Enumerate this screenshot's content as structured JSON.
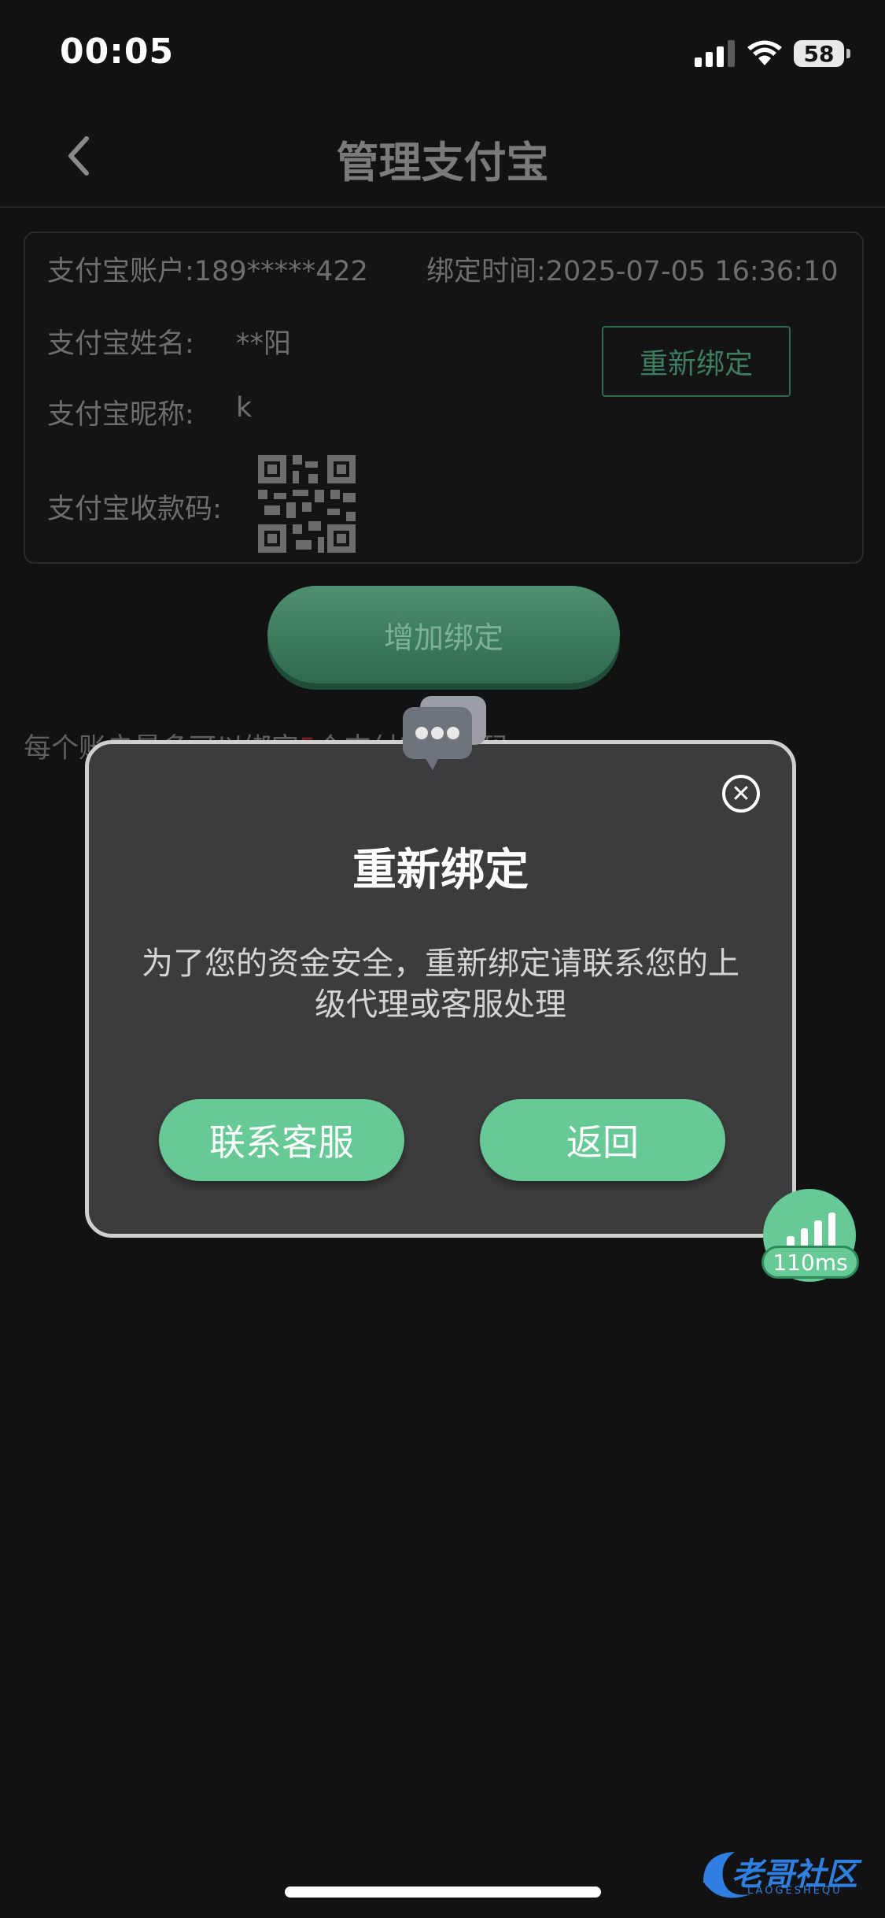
{
  "status_bar": {
    "time": "00:05",
    "battery": "58",
    "icons": [
      "cellular-signal-icon",
      "wifi-icon",
      "battery-icon"
    ]
  },
  "header": {
    "title": "管理支付宝",
    "back_icon": "chevron-left-icon"
  },
  "account_card": {
    "account_text": "支付宝账户:189*****422",
    "bind_time_text": "绑定时间:2025-07-05 16:36:10",
    "name_label": "支付宝姓名:",
    "name_value": "**阳",
    "nickname_label": "支付宝昵称:",
    "nickname_value": "k",
    "qr_label": "支付宝收款码:",
    "rebind_button": "重新绑定"
  },
  "add_bind_button": "增加绑定",
  "hint": {
    "prefix": "每个账户最多可以绑定",
    "count": "5",
    "suffix": "个支付宝收款码"
  },
  "modal": {
    "title": "重新绑定",
    "message": "为了您的资金安全，重新绑定请联系您的上级代理或客服处理",
    "contact_button": "联系客服",
    "back_button": "返回",
    "close_icon": "close-icon"
  },
  "latency": {
    "value": "110ms"
  },
  "watermark": {
    "text": "老哥社区",
    "subtext": "LAOGESHEQU"
  },
  "colors": {
    "accent_green": "#67c995",
    "dark_green": "#2f6a4e",
    "background": "#121214",
    "modal_bg": "#3c3c3e"
  }
}
